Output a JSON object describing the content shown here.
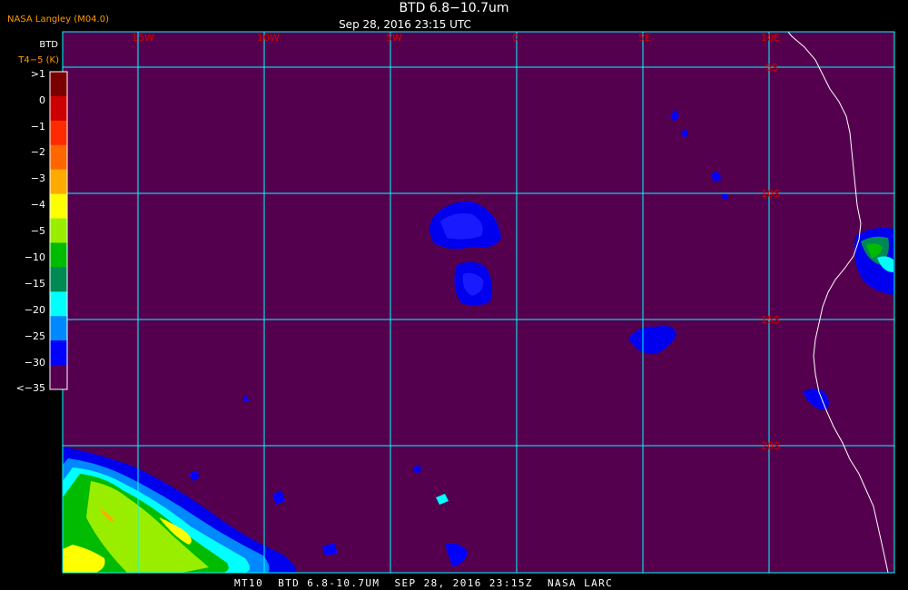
{
  "header": {
    "title": "BTD 6.8−10.7um",
    "subtitle": "Sep 28, 2016 23:15 UTC",
    "provider": "NASA Langley (M04.0)"
  },
  "colorbar": {
    "title_line1": "BTD",
    "title_line2": "T4−5 (K)",
    "labels": [
      ">1",
      "0",
      "−1",
      "−2",
      "−3",
      "−4",
      "−5",
      "−10",
      "−15",
      "−20",
      "−25",
      "−30",
      "<−35"
    ],
    "colors": [
      "#7a0000",
      "#cc0000",
      "#ff2a00",
      "#ff6600",
      "#ffaa00",
      "#ffff00",
      "#99ee00",
      "#00bb00",
      "#008855",
      "#00ffff",
      "#0088ff",
      "#0000ff",
      "#55004f"
    ]
  },
  "map": {
    "background_color": "#55004f",
    "grid_color": "#00ffff",
    "longitude_labels": [
      "15W",
      "10W",
      "5W",
      "0",
      "5E",
      "10E"
    ],
    "latitude_labels": [
      "5S",
      "10S",
      "15S",
      "20S"
    ],
    "label_color": "#cc0000"
  },
  "footer": {
    "text": "MT10  BTD 6.8-10.7UM  SEP 28, 2016 23:15Z  NASA LARC"
  }
}
